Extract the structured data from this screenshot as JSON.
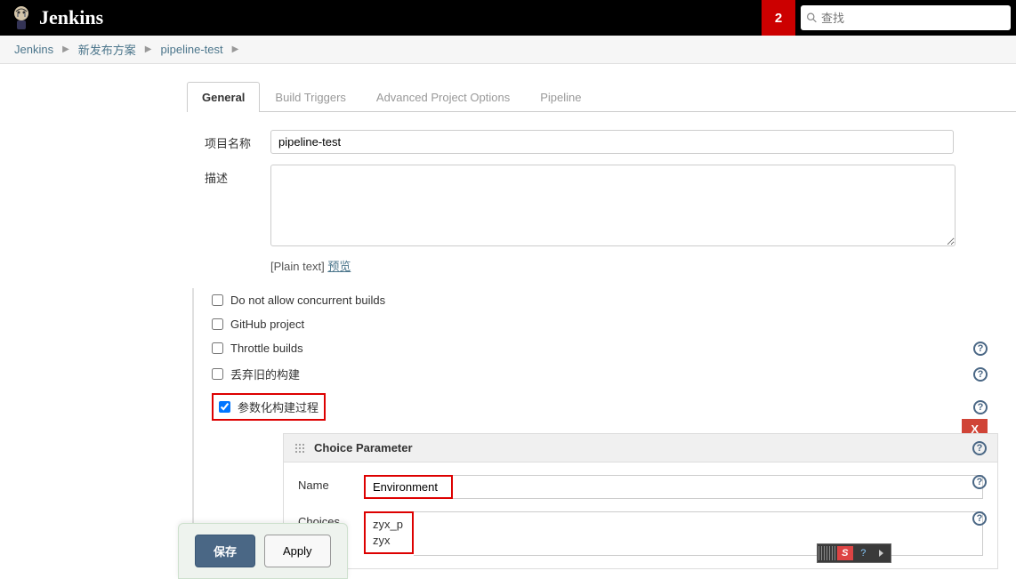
{
  "header": {
    "app_name": "Jenkins",
    "notification_count": "2",
    "search_placeholder": "查找"
  },
  "breadcrumbs": [
    {
      "label": "Jenkins"
    },
    {
      "label": "新发布方案"
    },
    {
      "label": "pipeline-test"
    }
  ],
  "tabs": [
    {
      "label": "General",
      "active": true
    },
    {
      "label": "Build Triggers",
      "active": false
    },
    {
      "label": "Advanced Project Options",
      "active": false
    },
    {
      "label": "Pipeline",
      "active": false
    }
  ],
  "form": {
    "project_name_label": "项目名称",
    "project_name_value": "pipeline-test",
    "description_label": "描述",
    "description_value": "",
    "plaintext_prefix": "[Plain text] ",
    "preview_label": "预览"
  },
  "checkboxes": [
    {
      "label": "Do not allow concurrent builds",
      "checked": false,
      "help": false
    },
    {
      "label": "GitHub project",
      "checked": false,
      "help": false
    },
    {
      "label": "Throttle builds",
      "checked": false,
      "help": true
    },
    {
      "label": "丢弃旧的构建",
      "checked": false,
      "help": true
    },
    {
      "label": "参数化构建过程",
      "checked": true,
      "help": true,
      "highlighted": true
    }
  ],
  "parameter": {
    "title": "Choice Parameter",
    "delete_label": "X",
    "name_label": "Name",
    "name_value": "Environment",
    "choices_label": "Choices",
    "choices_values": [
      "zyx_p",
      "zyx"
    ]
  },
  "buttons": {
    "save": "保存",
    "apply": "Apply"
  }
}
